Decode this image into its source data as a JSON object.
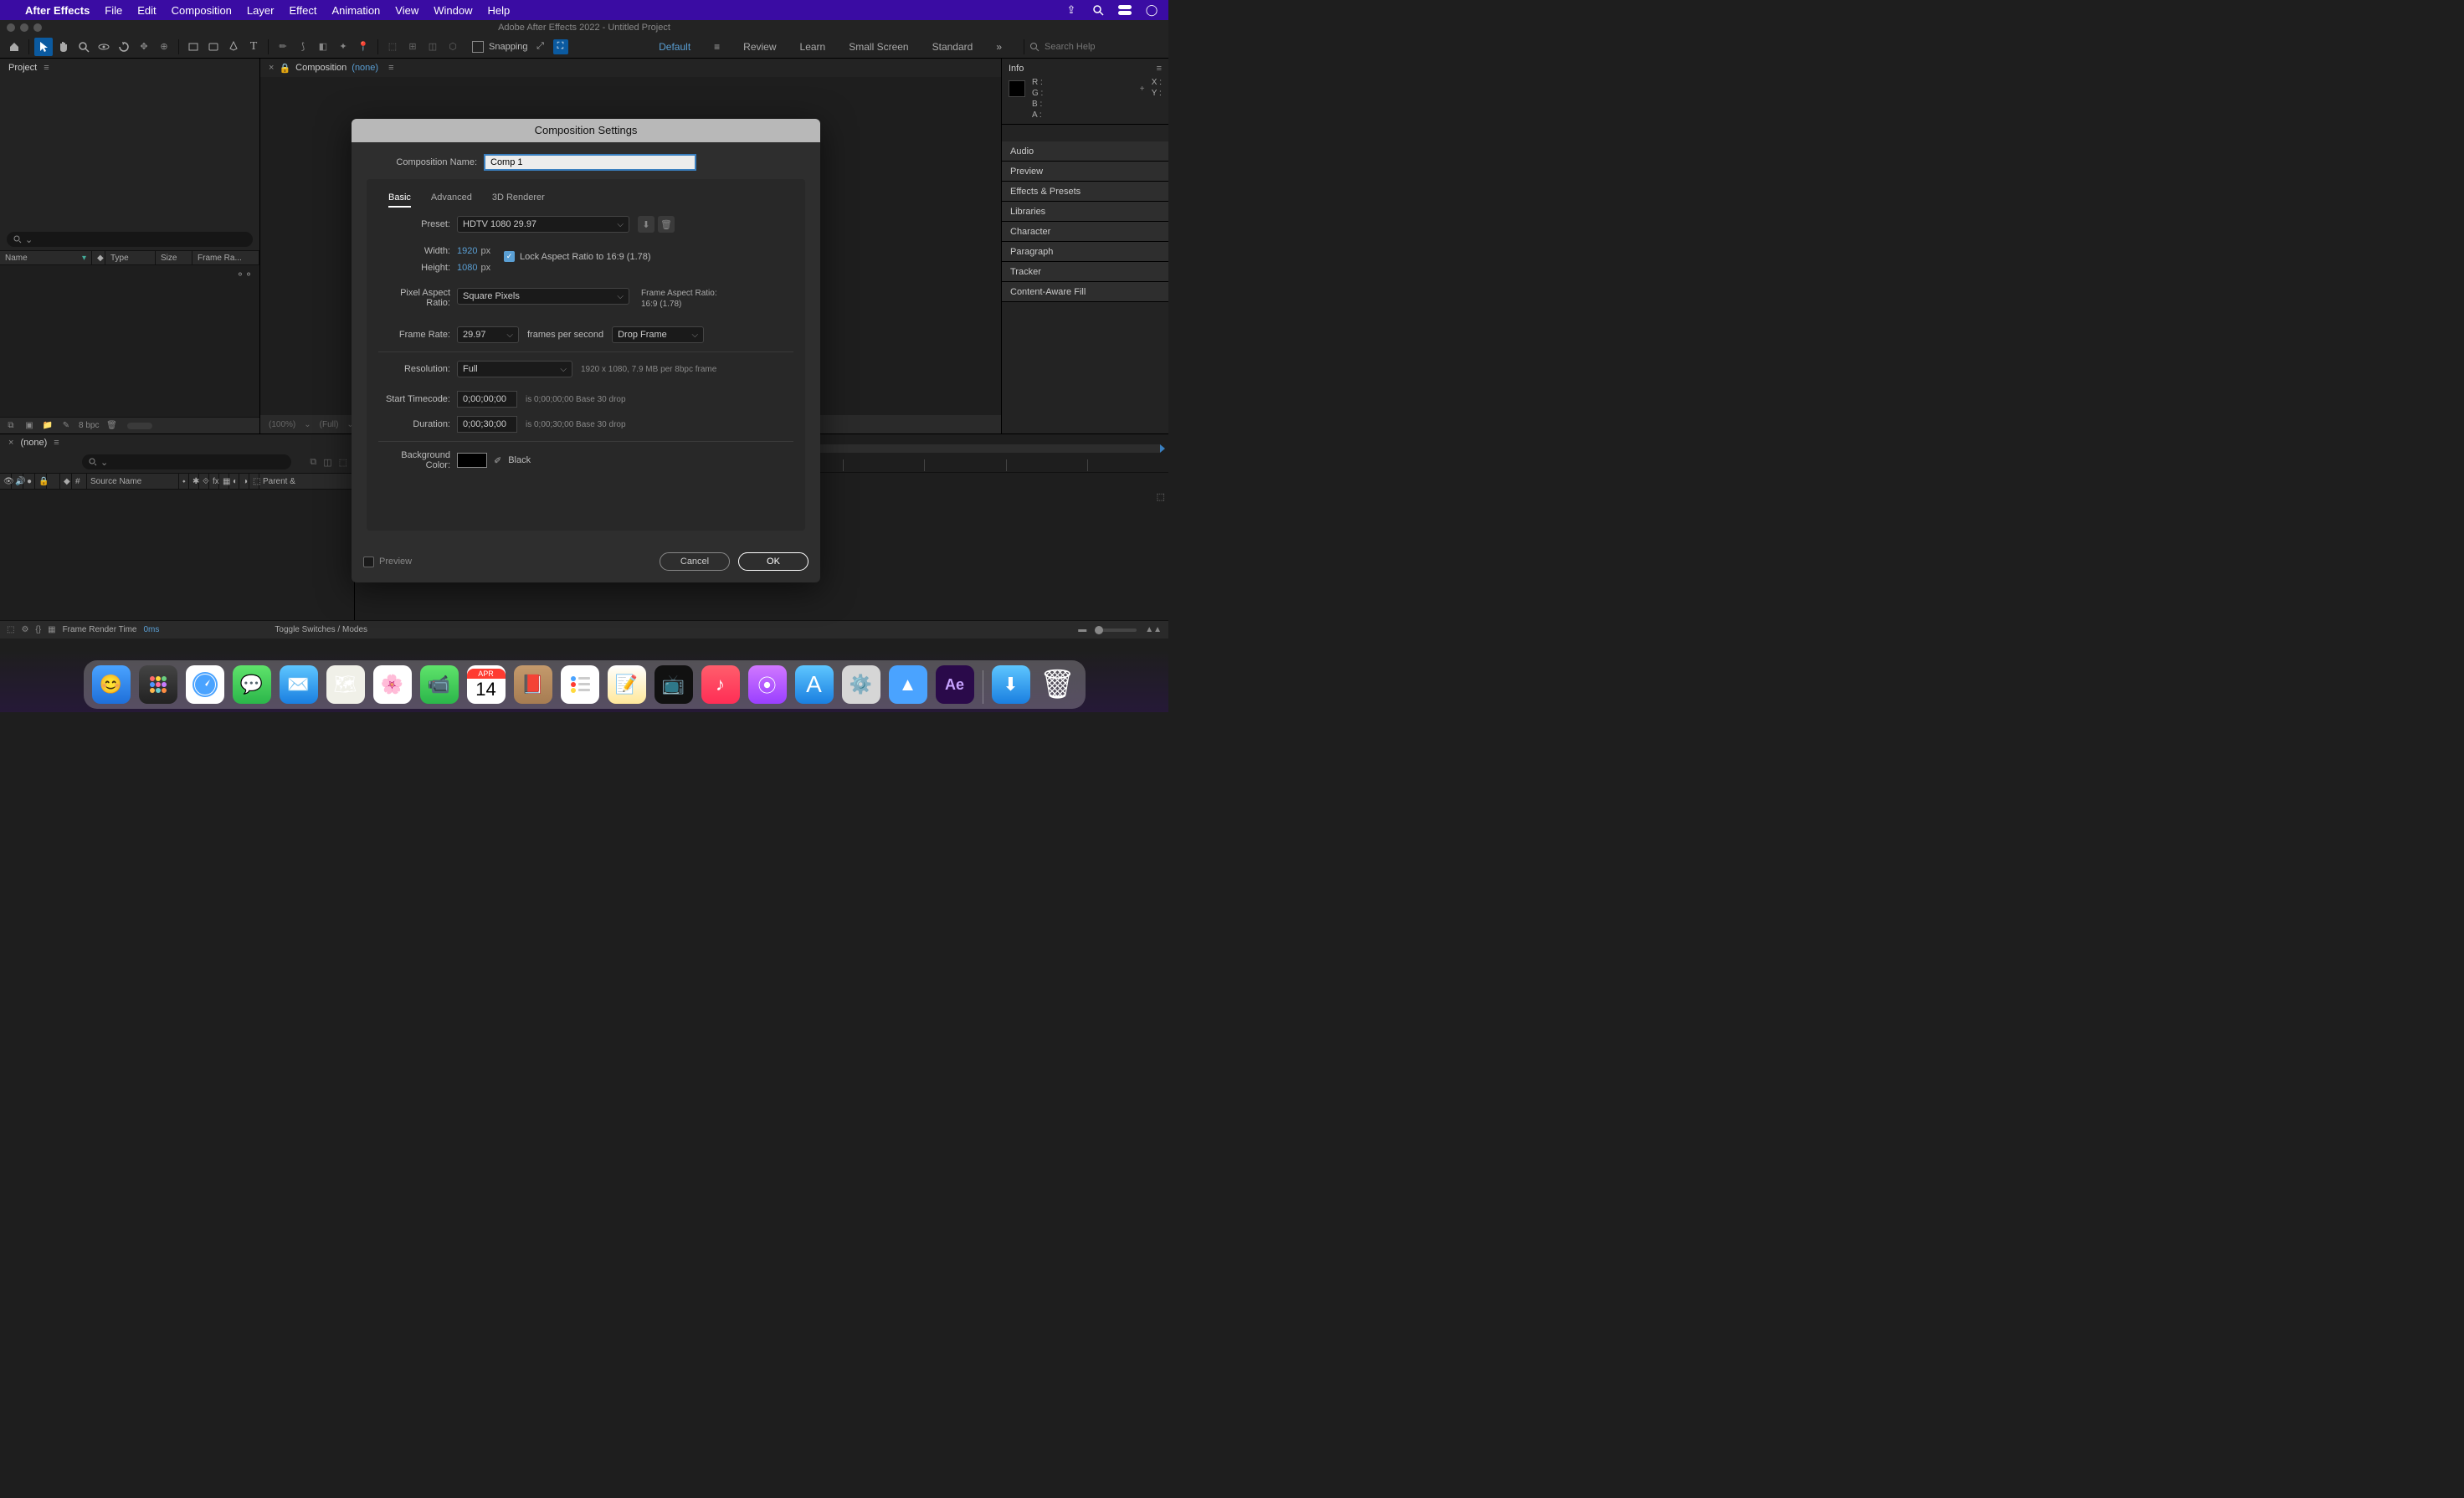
{
  "menubar": {
    "app": "After Effects",
    "items": [
      "File",
      "Edit",
      "Composition",
      "Layer",
      "Effect",
      "Animation",
      "View",
      "Window",
      "Help"
    ]
  },
  "window_title": "Adobe After Effects 2022 - Untitled Project",
  "toolbar": {
    "snapping_label": "Snapping",
    "workspaces": [
      "Default",
      "Review",
      "Learn",
      "Small Screen",
      "Standard"
    ],
    "search_placeholder": "Search Help"
  },
  "project": {
    "tab": "Project",
    "cols": {
      "name": "Name",
      "type": "Type",
      "size": "Size",
      "frame": "Frame Ra..."
    },
    "bpc": "8 bpc"
  },
  "comp": {
    "tab": "Composition",
    "none": "(none)",
    "zoom": "(100%)",
    "full": "(Full)"
  },
  "info": {
    "title": "Info",
    "r": "R :",
    "g": "G :",
    "b": "B :",
    "a": "A :",
    "x": "X :",
    "y": "Y :"
  },
  "panels": [
    "Audio",
    "Preview",
    "Effects & Presets",
    "Libraries",
    "Character",
    "Paragraph",
    "Tracker",
    "Content-Aware Fill"
  ],
  "timeline": {
    "tab": "(none)",
    "cols": {
      "src": "Source Name",
      "num": "#",
      "parent": "Parent &"
    },
    "footer": {
      "render": "Frame Render Time",
      "ms": "0ms",
      "toggle": "Toggle Switches / Modes"
    }
  },
  "dialog": {
    "title": "Composition Settings",
    "name_label": "Composition Name:",
    "name_value": "Comp 1",
    "tabs": [
      "Basic",
      "Advanced",
      "3D Renderer"
    ],
    "preset_label": "Preset:",
    "preset_value": "HDTV 1080 29.97",
    "width_label": "Width:",
    "width_value": "1920",
    "height_label": "Height:",
    "height_value": "1080",
    "px": "px",
    "lock_label": "Lock Aspect Ratio to 16:9 (1.78)",
    "par_label": "Pixel Aspect Ratio:",
    "par_value": "Square Pixels",
    "far_label": "Frame Aspect Ratio:",
    "far_value": "16:9 (1.78)",
    "fr_label": "Frame Rate:",
    "fr_value": "29.97",
    "fps": "frames per second",
    "drop_value": "Drop Frame",
    "res_label": "Resolution:",
    "res_value": "Full",
    "res_note": "1920 x 1080, 7.9 MB per 8bpc frame",
    "tc_label": "Start Timecode:",
    "tc_value": "0;00;00;00",
    "tc_note": "is 0;00;00;00  Base 30  drop",
    "dur_label": "Duration:",
    "dur_value": "0;00;30;00",
    "dur_note": "is 0;00;30;00  Base 30  drop",
    "bg_label": "Background Color:",
    "bg_name": "Black",
    "preview": "Preview",
    "cancel": "Cancel",
    "ok": "OK"
  },
  "dock": {
    "cal_month": "APR",
    "cal_day": "14",
    "ae": "Ae"
  }
}
